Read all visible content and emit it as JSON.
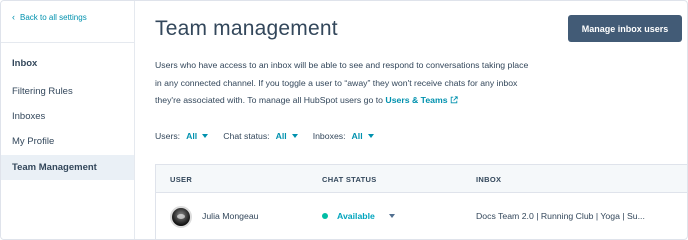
{
  "sidebar": {
    "back_link": "Back to all settings",
    "heading": "Inbox",
    "items": [
      {
        "label": "Filtering Rules",
        "active": false
      },
      {
        "label": "Inboxes",
        "active": false
      },
      {
        "label": "My Profile",
        "active": false
      },
      {
        "label": "Team Management",
        "active": true
      }
    ]
  },
  "header": {
    "title": "Team management",
    "manage_button": "Manage inbox users"
  },
  "description": {
    "text": "Users who have access to an inbox will be able to see and respond to conversations taking place in any connected channel. If you toggle a user to “away” they won't receive chats for any inbox they're associated with. To manage all HubSpot users go to",
    "link": "Users & Teams"
  },
  "filters": [
    {
      "label": "Users:",
      "value": "All"
    },
    {
      "label": "Chat status:",
      "value": "All"
    },
    {
      "label": "Inboxes:",
      "value": "All"
    }
  ],
  "table": {
    "columns": [
      "USER",
      "CHAT STATUS",
      "INBOX"
    ],
    "rows": [
      {
        "user": "Julia Mongeau",
        "status": "Available",
        "inbox": "Docs Team 2.0 | Running Club | Yoga | Su..."
      }
    ]
  },
  "colors": {
    "accent": "#0091ae",
    "button": "#425b76",
    "available": "#00bda5"
  }
}
